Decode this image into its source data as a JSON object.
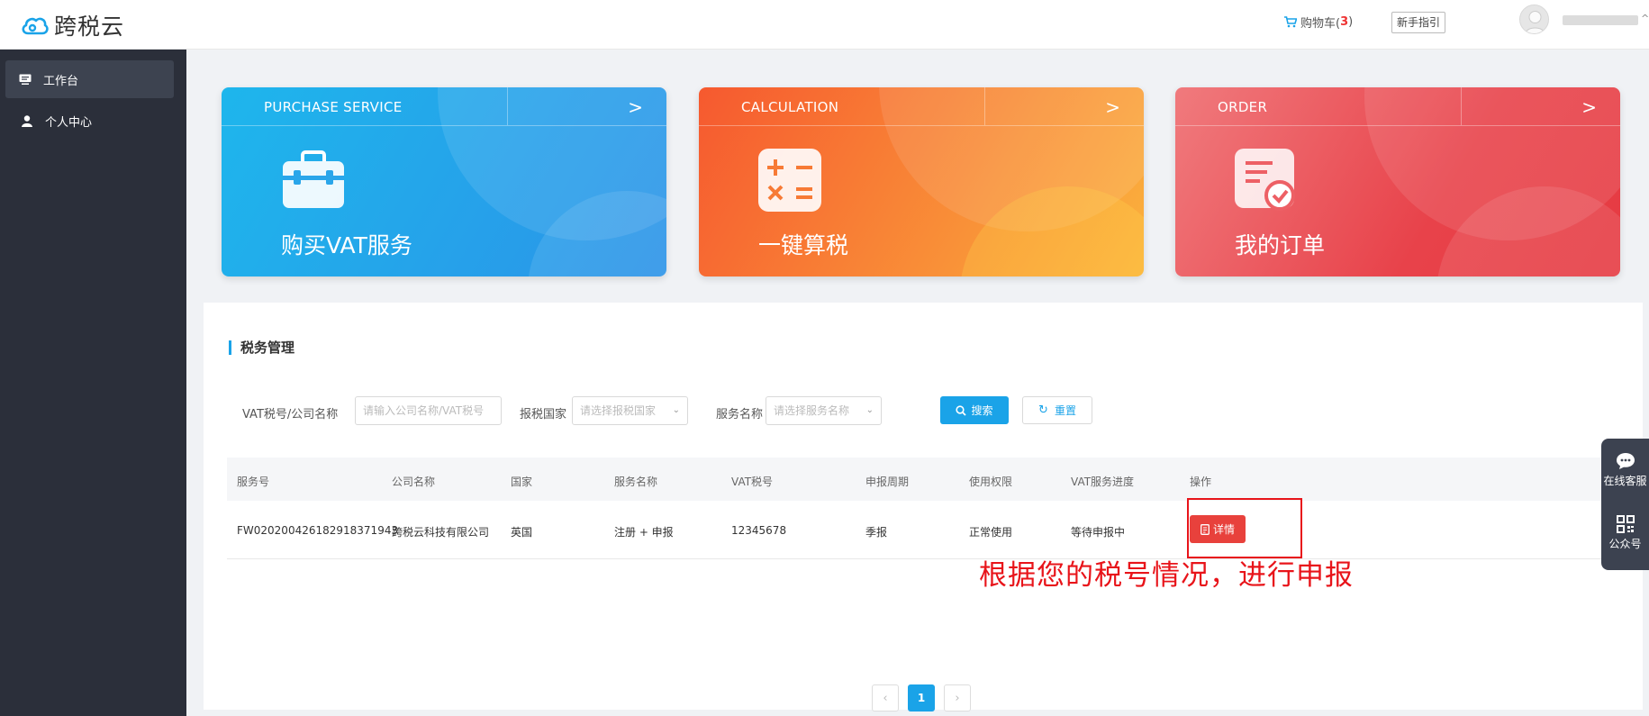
{
  "brand": {
    "name": "跨税云"
  },
  "header": {
    "cart_label": "购物车(",
    "cart_count": "3",
    "cart_close": ")",
    "guide_label": "新手指引"
  },
  "sidebar": {
    "items": [
      {
        "label": "工作台",
        "icon": "monitor-icon",
        "active": true
      },
      {
        "label": "个人中心",
        "icon": "user-icon",
        "active": false
      }
    ]
  },
  "cards": [
    {
      "title": "PURCHASE SERVICE",
      "label": "购买VAT服务",
      "icon": "toolbox-icon",
      "color_from": "#1eb6ec",
      "color_to": "#2b93e8"
    },
    {
      "title": "CALCULATION",
      "label": "一键算税",
      "icon": "calculator-icon",
      "color_from": "#f6592f",
      "color_to": "#fbb23d"
    },
    {
      "title": "ORDER",
      "label": "我的订单",
      "icon": "order-icon",
      "color_from": "#e8424a",
      "color_to": "#f06f74"
    }
  ],
  "section": {
    "title": "税务管理"
  },
  "filters": {
    "vat_label": "VAT税号/公司名称",
    "vat_placeholder": "请输入公司名称/VAT税号",
    "country_label": "报税国家",
    "country_placeholder": "请选择报税国家",
    "service_label": "服务名称",
    "service_placeholder": "请选择服务名称",
    "search_label": "搜索",
    "reset_label": "重置"
  },
  "table": {
    "headers": [
      "服务号",
      "公司名称",
      "国家",
      "服务名称",
      "VAT税号",
      "申报周期",
      "使用权限",
      "VAT服务进度",
      "操作"
    ],
    "rows": [
      {
        "service_no": "FW020200426182918371943",
        "company": "跨税云科技有限公司",
        "country": "英国",
        "service_name": "注册 + 申报",
        "vat_no": "12345678",
        "period": "季报",
        "permission": "正常使用",
        "progress": "等待申报中",
        "action": "详情"
      }
    ]
  },
  "annotation": "根据您的税号情况，进行申报",
  "pagination": {
    "prev": "‹",
    "current": "1",
    "next": "›"
  },
  "float_tools": [
    {
      "label": "在线客服",
      "icon": "chat-icon"
    },
    {
      "label": "公众号",
      "icon": "qrcode-icon"
    }
  ],
  "colors": {
    "accent": "#1aa3e8",
    "sidebar": "#2b2f3a",
    "danger": "#e8413c",
    "annotation": "#e8141a"
  }
}
